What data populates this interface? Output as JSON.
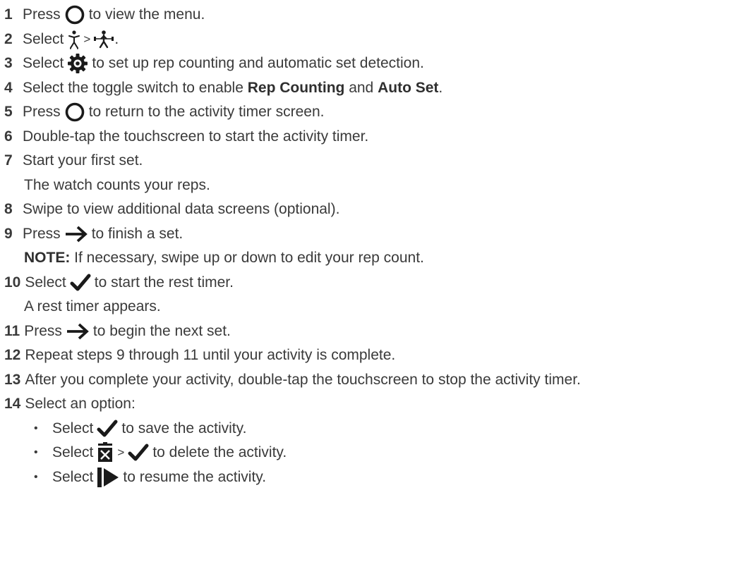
{
  "steps": [
    {
      "num": "1",
      "pre": "Press",
      "post": "to view the menu."
    },
    {
      "num": "2",
      "pre": "Select",
      "sep": ">",
      "post": "."
    },
    {
      "num": "3",
      "pre": "Select",
      "post": "to set up rep counting and automatic set detection."
    },
    {
      "num": "4",
      "pre": "Select the toggle switch to enable",
      "bold1": "Rep Counting",
      "mid": "and",
      "bold2": "Auto Set",
      "post": "."
    },
    {
      "num": "5",
      "pre": "Press",
      "post": "to return to the activity timer screen."
    },
    {
      "num": "6",
      "text": "Double-tap the touchscreen to start the activity timer."
    },
    {
      "num": "7",
      "text": "Start your first set.",
      "sub": "The watch counts your reps."
    },
    {
      "num": "8",
      "text": "Swipe to view additional data screens (optional)."
    },
    {
      "num": "9",
      "pre": "Press",
      "post": "to finish a set.",
      "note_label": "NOTE:",
      "note": "If necessary, swipe up or down to edit your rep count."
    },
    {
      "num": "10",
      "pre": "Select",
      "post": "to start the rest timer.",
      "sub": "A rest timer appears."
    },
    {
      "num": "11",
      "pre": "Press",
      "post": "to begin the next set."
    },
    {
      "num": "12",
      "text": "Repeat steps 9 through 11 until your activity is complete."
    },
    {
      "num": "13",
      "text": "After you complete your activity, double-tap the touchscreen to stop the activity timer."
    },
    {
      "num": "14",
      "text": "Select an option:"
    }
  ],
  "options": [
    {
      "bullet": "•",
      "pre": "Select",
      "post": "to save the activity."
    },
    {
      "bullet": "•",
      "pre": "Select",
      "sep": ">",
      "post": "to delete the activity."
    },
    {
      "bullet": "•",
      "pre": "Select",
      "post": "to resume the activity."
    }
  ],
  "colors": {
    "text": "#3a3a3a",
    "icon": "#1a1a1a"
  },
  "icons": [
    "back-button-icon",
    "strength-activity-icon",
    "barbell-icon",
    "settings-gear-icon",
    "arrow-right-icon",
    "checkmark-icon",
    "trash-icon",
    "resume-icon"
  ]
}
